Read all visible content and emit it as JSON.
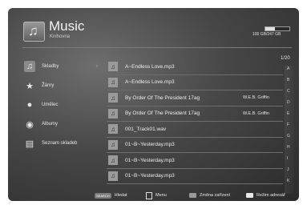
{
  "header": {
    "title": "Music",
    "subtitle": "Knihovna",
    "storage_text": "100 GB/247 GB",
    "storage_fraction": 0.4
  },
  "sidebar": {
    "items": [
      {
        "label": "Skladby",
        "icon": "music-note-icon",
        "active": true
      },
      {
        "label": "Žánry",
        "icon": "star-icon",
        "active": false
      },
      {
        "label": "Umělec",
        "icon": "person-icon",
        "active": false
      },
      {
        "label": "Albumy",
        "icon": "disc-icon",
        "active": false
      },
      {
        "label": "Seznam skladeb",
        "icon": "playlist-icon",
        "active": false
      }
    ]
  },
  "list": {
    "page": "1/20",
    "rows": [
      {
        "title": "A~Endless Love.mp3",
        "artist": ""
      },
      {
        "title": "A~Endless Love.mp3",
        "artist": ""
      },
      {
        "title": "By Order Of The President 17ag",
        "artist": "W.E.B. Griffin"
      },
      {
        "title": "By Order Of The President 17ag",
        "artist": "W.E.B. Griffin"
      },
      {
        "title": "001_Track01.wav",
        "artist": ""
      },
      {
        "title": "01~B~Yesterday.mp3",
        "artist": ""
      },
      {
        "title": "01~B~Yesterday.mp3",
        "artist": ""
      },
      {
        "title": "01~B~Yesterday.mp3",
        "artist": ""
      }
    ]
  },
  "alphabet": [
    "A",
    "B",
    "C",
    "D",
    "E",
    "F",
    "G",
    "H",
    "I",
    "J",
    "K"
  ],
  "footer": {
    "search_key": "SEARCH",
    "search_label": "Hledat",
    "menu_label": "Menu",
    "device_label": "Změna zařízení",
    "mode_label": "Režim adresář"
  }
}
